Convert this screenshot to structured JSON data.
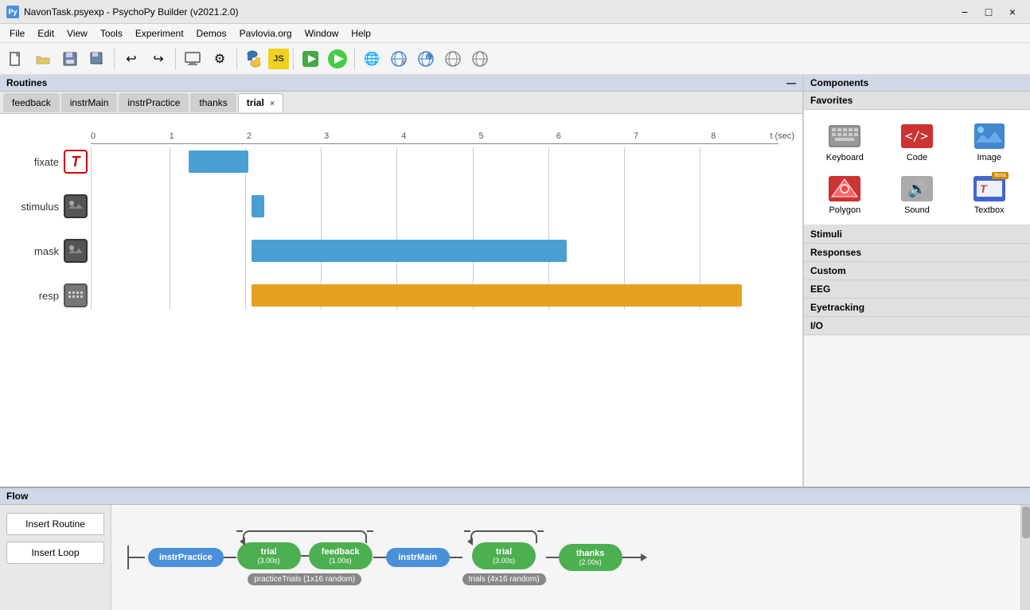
{
  "titlebar": {
    "title": "NavonTask.psyexp - PsychoPy Builder (v2021.2.0)",
    "icon_text": "Py",
    "min_label": "−",
    "max_label": "□",
    "close_label": "×"
  },
  "menubar": {
    "items": [
      "File",
      "Edit",
      "View",
      "Tools",
      "Experiment",
      "Demos",
      "Pavlovia.org",
      "Window",
      "Help"
    ]
  },
  "toolbar": {
    "buttons": [
      {
        "name": "new-btn",
        "icon": "📄"
      },
      {
        "name": "open-btn",
        "icon": "📂"
      },
      {
        "name": "save-btn",
        "icon": "💾"
      },
      {
        "name": "save-as-btn",
        "icon": "💾"
      },
      {
        "name": "undo-btn",
        "icon": "↩"
      },
      {
        "name": "redo-btn",
        "icon": "↪"
      },
      {
        "name": "monitor-btn",
        "icon": "🖥"
      },
      {
        "name": "settings-btn",
        "icon": "⚙"
      },
      {
        "name": "python-btn",
        "icon": "🐍"
      },
      {
        "name": "js-btn",
        "icon": "JS"
      },
      {
        "name": "run-green-btn",
        "icon": "▶"
      },
      {
        "name": "run-btn",
        "icon": "▶"
      },
      {
        "name": "globe1-btn",
        "icon": "🌐"
      },
      {
        "name": "globe2-btn",
        "icon": "🌐"
      },
      {
        "name": "globe3-btn",
        "icon": "🌐"
      },
      {
        "name": "globe4-btn",
        "icon": "🌐"
      },
      {
        "name": "globe5-btn",
        "icon": "🌐"
      }
    ]
  },
  "routines": {
    "header": "Routines",
    "tabs": [
      {
        "label": "feedback",
        "active": false,
        "closable": false
      },
      {
        "label": "instrMain",
        "active": false,
        "closable": false
      },
      {
        "label": "instrPractice",
        "active": false,
        "closable": false
      },
      {
        "label": "thanks",
        "active": false,
        "closable": false
      },
      {
        "label": "trial",
        "active": true,
        "closable": true
      }
    ]
  },
  "timeline": {
    "time_ticks": [
      "0",
      "1",
      "2",
      "3",
      "4",
      "5",
      "6",
      "7",
      "8"
    ],
    "time_unit": "t (sec)",
    "rows": [
      {
        "label": "fixate",
        "icon_type": "text",
        "icon_char": "T",
        "bars": [
          {
            "start_pct": 13.5,
            "width_pct": 8.5,
            "color": "blue"
          }
        ]
      },
      {
        "label": "stimulus",
        "icon_type": "image",
        "icon_char": "🖼",
        "bars": [
          {
            "start_pct": 21.8,
            "width_pct": 1.3,
            "color": "blue"
          }
        ]
      },
      {
        "label": "mask",
        "icon_type": "image",
        "icon_char": "🖼",
        "bars": [
          {
            "start_pct": 21.8,
            "width_pct": 44.5,
            "color": "blue"
          }
        ]
      },
      {
        "label": "resp",
        "icon_type": "keyboard",
        "icon_char": "⌨",
        "bars": [
          {
            "start_pct": 21.8,
            "width_pct": 70.2,
            "color": "orange"
          }
        ]
      }
    ]
  },
  "components": {
    "header": "Components",
    "favorites_label": "Favorites",
    "items": [
      {
        "name": "Keyboard",
        "icon": "keyboard"
      },
      {
        "name": "Code",
        "icon": "code"
      },
      {
        "name": "Image",
        "icon": "image"
      },
      {
        "name": "Polygon",
        "icon": "polygon"
      },
      {
        "name": "Sound",
        "icon": "sound"
      },
      {
        "name": "Textbox",
        "icon": "textbox",
        "beta": true
      }
    ],
    "sections": [
      "Stimuli",
      "Responses",
      "Custom",
      "EEG",
      "Eyetracking",
      "I/O"
    ]
  },
  "flow": {
    "header": "Flow",
    "insert_routine_label": "Insert Routine",
    "insert_loop_label": "Insert Loop",
    "nodes": [
      {
        "label": "instrPractice",
        "color": "blue"
      },
      {
        "label": "trial",
        "sub": "(3.00s)",
        "color": "green"
      },
      {
        "label": "feedback",
        "sub": "(1.00s)",
        "color": "green"
      },
      {
        "label": "instrMain",
        "color": "blue"
      },
      {
        "label": "trial",
        "sub": "(3.00s)",
        "color": "green"
      },
      {
        "label": "thanks",
        "sub": "(2.00s)",
        "color": "green"
      }
    ],
    "loops": [
      {
        "label": "practiceTrials (1x16 random)",
        "color": "gray"
      },
      {
        "label": "trials (4x16 random)",
        "color": "gray"
      }
    ]
  }
}
